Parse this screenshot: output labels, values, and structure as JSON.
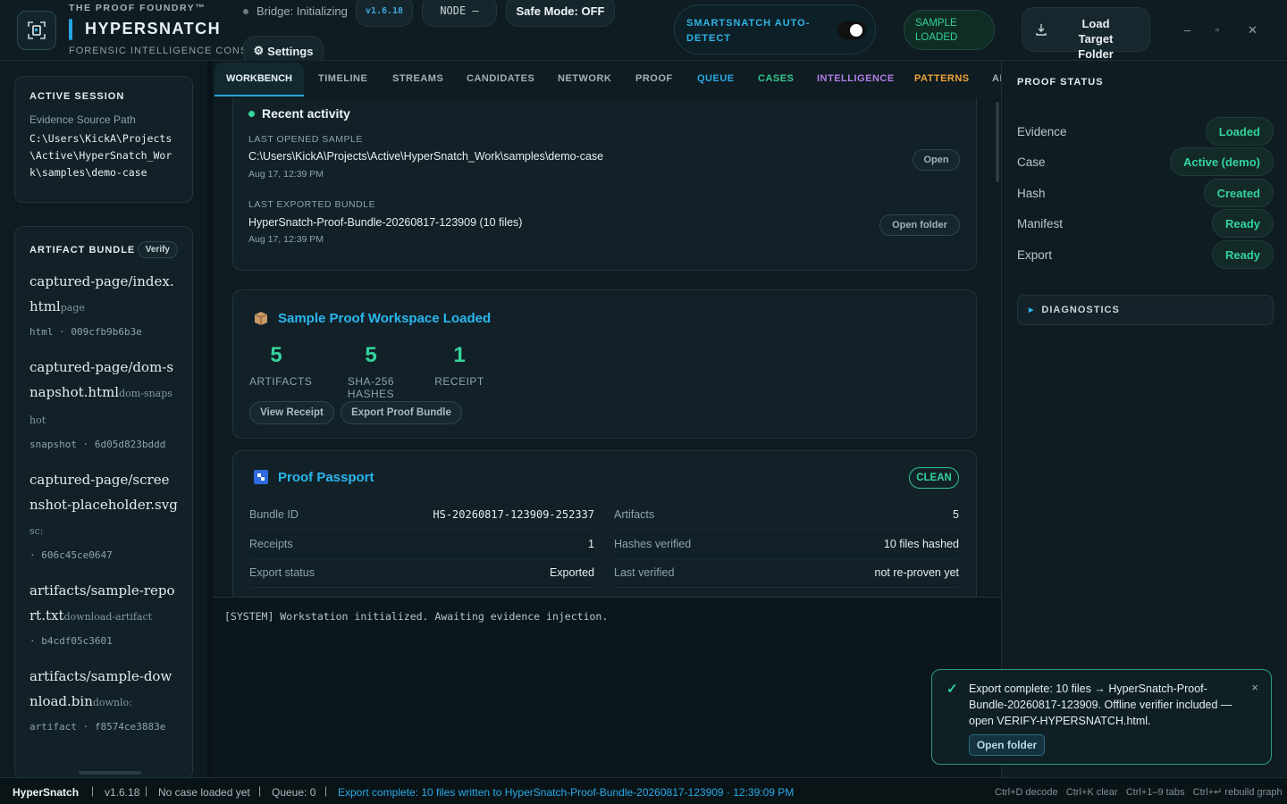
{
  "header": {
    "kicker": "THE PROOF FOUNDRY™",
    "app_name": "HYPERSNATCH",
    "subtitle": "FORENSIC INTELLIGENCE CONSOLE",
    "bridge_status": "Bridge: Initializing",
    "version_pill": "v1.6.18",
    "node_pill": "NODE —",
    "safe_mode": "Safe Mode: OFF",
    "settings_label": "Settings",
    "autodetect_label": "SMARTSNATCH AUTO-DETECT",
    "autodetect_enabled": true,
    "sample_badge": "SAMPLE LOADED",
    "load_button": "Load Target Folder",
    "window_minimize": "–",
    "window_maximize": "▫",
    "window_close": "✕"
  },
  "sidebar": {
    "session": {
      "title": "ACTIVE SESSION",
      "source_label": "Evidence Source Path",
      "source_path": "C:\\Users\\KickA\\Projects\\Active\\HyperSnatch_Work\\samples\\demo-case"
    },
    "bundle": {
      "title": "ARTIFACT BUNDLE",
      "verify_label": "Verify",
      "items": [
        {
          "path": "captured-page/index.html",
          "kind": "page",
          "meta": "html · 009cfb9b6b3e"
        },
        {
          "path": "captured-page/dom-snapshot.html",
          "kind": "dom-snapshot",
          "meta": "snapshot · 6d05d823bddd"
        },
        {
          "path": "captured-page/screenshot-placeholder.svg",
          "kind": "sc:",
          "meta": "· 606c45ce0647"
        },
        {
          "path": "artifacts/sample-report.txt",
          "kind": "download-artifact",
          "meta": "· b4cdf05c3601"
        },
        {
          "path": "artifacts/sample-download.bin",
          "kind": "downlo:",
          "meta": "artifact · f8574ce3883e"
        }
      ]
    }
  },
  "tabs": [
    {
      "label": "WORKBENCH",
      "color": "#e9f3f6",
      "active": true
    },
    {
      "label": "TIMELINE",
      "color": "#9fb2b9"
    },
    {
      "label": "STREAMS",
      "color": "#9fb2b9"
    },
    {
      "label": "CANDIDATES",
      "color": "#9fb2b9"
    },
    {
      "label": "NETWORK",
      "color": "#9fb2b9"
    },
    {
      "label": "PROOF",
      "color": "#9fb2b9"
    },
    {
      "label": "QUEUE",
      "color": "#2aa8e6"
    },
    {
      "label": "CASES",
      "color": "#34c98f"
    },
    {
      "label": "INTELLIGENCE",
      "color": "#b07ee8"
    },
    {
      "label": "PATTERNS",
      "color": "#f0a23a"
    },
    {
      "label": "AI",
      "color": "#9fb2b9"
    }
  ],
  "recent": {
    "title": "Recent activity",
    "opened_label": "LAST OPENED SAMPLE",
    "opened_path": "C:\\Users\\KickA\\Projects\\Active\\HyperSnatch_Work\\samples\\demo-case",
    "opened_time": "Aug 17, 12:39 PM",
    "open_button": "Open",
    "exported_label": "LAST EXPORTED BUNDLE",
    "exported_name": "HyperSnatch-Proof-Bundle-20260817-123909 (10 files)",
    "exported_time": "Aug 17, 12:39 PM",
    "open_folder_button": "Open folder"
  },
  "workspace": {
    "title": "Sample Proof Workspace Loaded",
    "stats": [
      {
        "value": "5",
        "label": "ARTIFACTS"
      },
      {
        "value": "5",
        "label": "SHA-256 HASHES"
      },
      {
        "value": "1",
        "label": "RECEIPT"
      }
    ],
    "view_receipt": "View Receipt",
    "export_bundle": "Export Proof Bundle"
  },
  "passport": {
    "title": "Proof Passport",
    "badge": "CLEAN",
    "bundle_id_label": "Bundle ID",
    "bundle_id": "HS-20260817-123909-252337",
    "artifacts_label": "Artifacts",
    "artifacts": "5",
    "receipts_label": "Receipts",
    "receipts": "1",
    "hashes_label": "Hashes verified",
    "hashes": "10 files hashed",
    "export_label": "Export status",
    "export_status": "Exported",
    "last_verified_label": "Last verified",
    "last_verified": "not re-proven yet"
  },
  "console": {
    "line": "[SYSTEM] Workstation initialized. Awaiting evidence injection."
  },
  "proof_status": {
    "title": "PROOF STATUS",
    "rows": [
      {
        "label": "Evidence",
        "value": "Loaded"
      },
      {
        "label": "Case",
        "value": "Active (demo)"
      },
      {
        "label": "Hash",
        "value": "Created"
      },
      {
        "label": "Manifest",
        "value": "Ready"
      },
      {
        "label": "Export",
        "value": "Ready"
      }
    ],
    "diagnostics": "DIAGNOSTICS"
  },
  "toast": {
    "message": "Export complete: 10 files → HyperSnatch-Proof-Bundle-20260817-123909. Offline verifier included — open VERIFY-HYPERSNATCH.html.",
    "button": "Open folder",
    "close": "×"
  },
  "statusbar": {
    "app": "HyperSnatch",
    "version": "v1.6.18",
    "case": "No case loaded yet",
    "queue": "Queue: 0",
    "message": "Export complete: 10 files written to HyperSnatch-Proof-Bundle-20260817-123909 · 12:39:09 PM",
    "shortcuts": "Ctrl+D decode   Ctrl+K clear   Ctrl+1–9 tabs   Ctrl+↵ rebuild graph"
  },
  "colors": {
    "accent": "#2ab6ee",
    "success": "#34d39b",
    "background": "#0d1a1f"
  }
}
